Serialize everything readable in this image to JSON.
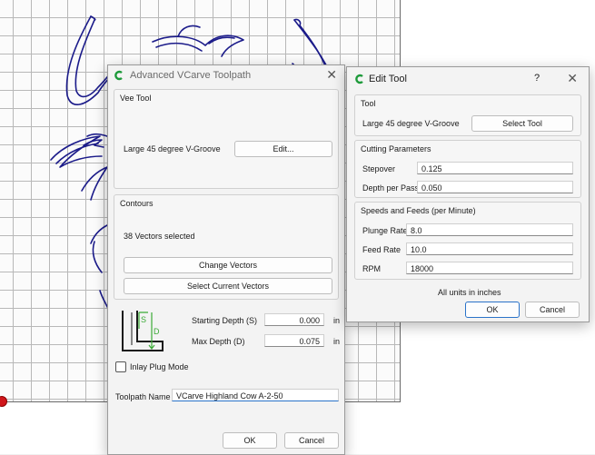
{
  "background": {
    "grid_color": "#b8b8b8",
    "art_color": "#1b1b8a"
  },
  "advanced_dialog": {
    "title": "Advanced VCarve Toolpath",
    "vee_tool": {
      "group_label": "Vee Tool",
      "tool_name": "Large 45 degree V-Groove",
      "edit_button": "Edit..."
    },
    "contours": {
      "group_label": "Contours",
      "selection_status": "38 Vectors selected",
      "change_button": "Change Vectors",
      "select_current_button": "Select Current Vectors"
    },
    "depth": {
      "diagram_s": "S",
      "diagram_d": "D",
      "starting_label": "Starting Depth (S)",
      "starting_value": "0.000",
      "max_label": "Max Depth (D)",
      "max_value": "0.075",
      "unit": "in"
    },
    "inlay_label": "Inlay Plug Mode",
    "toolpath_name_label": "Toolpath Name",
    "toolpath_name_value": "VCarve Highland Cow A-2-50",
    "ok_button": "OK",
    "cancel_button": "Cancel"
  },
  "edit_tool_dialog": {
    "title": "Edit Tool",
    "help": "?",
    "tool": {
      "group_label": "Tool",
      "tool_name": "Large 45 degree V-Groove",
      "select_button": "Select Tool"
    },
    "cutting": {
      "group_label": "Cutting Parameters",
      "stepover_label": "Stepover",
      "stepover_value": "0.125",
      "depth_pass_label": "Depth per Pass",
      "depth_pass_value": "0.050"
    },
    "feeds": {
      "group_label": "Speeds and Feeds (per Minute)",
      "plunge_label": "Plunge Rate",
      "plunge_value": "8.0",
      "feed_label": "Feed Rate",
      "feed_value": "10.0",
      "rpm_label": "RPM",
      "rpm_value": "18000"
    },
    "units_note": "All units in inches",
    "ok_button": "OK",
    "cancel_button": "Cancel"
  }
}
